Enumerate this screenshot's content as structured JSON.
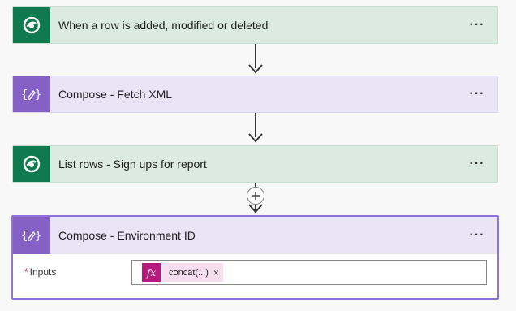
{
  "steps": [
    {
      "title": "When a row is added, modified or deleted",
      "icon": "dataverse-icon",
      "more": "···"
    },
    {
      "title": "Compose - Fetch XML",
      "icon": "compose-icon",
      "more": "···"
    },
    {
      "title": "List rows - Sign ups for report",
      "icon": "dataverse-icon",
      "more": "···"
    },
    {
      "title": "Compose - Environment ID",
      "icon": "compose-icon",
      "more": "···"
    }
  ],
  "expanded": {
    "inputs_required": "*",
    "inputs_label": "Inputs",
    "token": {
      "icon_text": "fx",
      "label": "concat(...)",
      "remove": "×"
    }
  },
  "colors": {
    "dataverse": "#0e7a4e",
    "compose": "#8661c5",
    "token_fx": "#b7197c"
  }
}
